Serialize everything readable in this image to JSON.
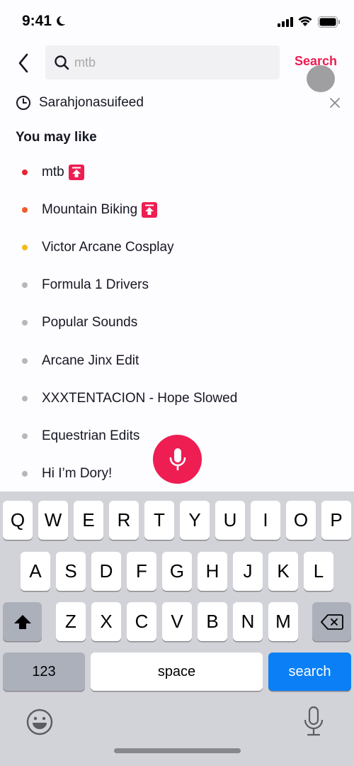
{
  "status_bar": {
    "time": "9:41",
    "icons": [
      "moon-icon",
      "signal-icon",
      "wifi-icon",
      "battery-icon"
    ]
  },
  "header": {
    "back_icon": "chevron-left-icon",
    "search_icon": "search-icon",
    "search_value": "mtb",
    "search_button_label": "Search"
  },
  "history": {
    "icon": "clock-icon",
    "text": "Sarahjonasuifeed",
    "remove_icon": "close-icon"
  },
  "suggestions": {
    "title": "You may like",
    "items": [
      {
        "label": "mtb",
        "dot_color": "#e8232f",
        "hot": true
      },
      {
        "label": "Mountain Biking",
        "dot_color": "#f25a2a",
        "hot": true
      },
      {
        "label": "Victor Arcane Cosplay",
        "dot_color": "#f5b91d",
        "hot": false
      },
      {
        "label": "Formula 1 Drivers",
        "dot_color": "#b7b7ba",
        "hot": false
      },
      {
        "label": "Popular Sounds",
        "dot_color": "#b7b7ba",
        "hot": false
      },
      {
        "label": "Arcane Jinx Edit",
        "dot_color": "#b7b7ba",
        "hot": false
      },
      {
        "label": "XXXTENTACION - Hope Slowed",
        "dot_color": "#b7b7ba",
        "hot": false
      },
      {
        "label": "Equestrian Edits",
        "dot_color": "#b7b7ba",
        "hot": false
      },
      {
        "label": "Hi I’m Dory!",
        "dot_color": "#b7b7ba",
        "hot": false
      }
    ]
  },
  "voice_button": {
    "icon": "microphone-icon",
    "color": "#ee1d52"
  },
  "keyboard": {
    "row1": [
      "Q",
      "W",
      "E",
      "R",
      "T",
      "Y",
      "U",
      "I",
      "O",
      "P"
    ],
    "row2": [
      "A",
      "S",
      "D",
      "F",
      "G",
      "H",
      "J",
      "K",
      "L"
    ],
    "row3": [
      "Z",
      "X",
      "C",
      "V",
      "B",
      "N",
      "M"
    ],
    "shift_icon": "shift-icon",
    "delete_icon": "backspace-icon",
    "numbers_label": "123",
    "space_label": "space",
    "return_label": "search",
    "emoji_icon": "emoji-icon",
    "dictation_icon": "microphone-icon"
  },
  "colors": {
    "accent": "#ee1d52",
    "keyboard_return": "#0b7ff5"
  }
}
